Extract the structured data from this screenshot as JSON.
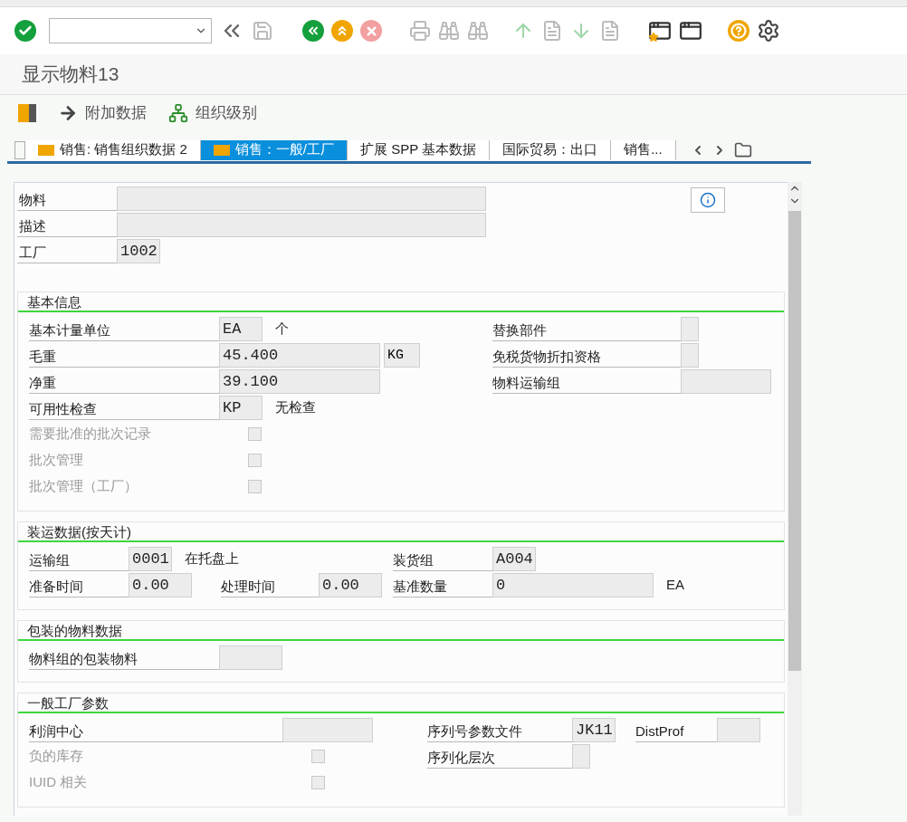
{
  "title": "显示物料13",
  "actions": [
    {
      "label": "附加数据"
    },
    {
      "label": "组织级别"
    }
  ],
  "tabs": [
    {
      "label": "销售: 销售组织数据 2",
      "selected": false
    },
    {
      "label": "销售：一般/工厂",
      "selected": true
    },
    {
      "label": "扩展 SPP 基本数据",
      "selected": false
    },
    {
      "label": "国际贸易：出口",
      "selected": false
    },
    {
      "label": "销售...",
      "selected": false
    }
  ],
  "header_fields": [
    {
      "label": "物料",
      "kind": "long"
    },
    {
      "label": "描述",
      "kind": "long"
    },
    {
      "label": "工厂",
      "kind": "code",
      "value": "1002"
    }
  ],
  "sections": [
    {
      "title": "基本信息",
      "kind": "basic",
      "rows": [
        [
          {
            "kind": "code",
            "label": "基本计量单位",
            "value": "EA",
            "suffix": "个"
          },
          {
            "kind": "flag",
            "label": "替换部件"
          }
        ],
        [
          {
            "kind": "quantity",
            "label": "毛重",
            "value": "45.400",
            "unit": "KG"
          },
          {
            "kind": "flag",
            "label": "免税货物折扣资格"
          }
        ],
        [
          {
            "kind": "quantity",
            "label": "净重",
            "value": "39.100"
          },
          {
            "kind": "wide",
            "label": "物料运输组"
          }
        ],
        [
          {
            "kind": "code",
            "label": "可用性检查",
            "value": "KP",
            "suffix": "无检查"
          }
        ],
        [
          {
            "kind": "checkbox",
            "label": "需要批准的批次记录",
            "checked": false,
            "disabled": true
          }
        ],
        [
          {
            "kind": "checkbox",
            "label": "批次管理",
            "checked": false,
            "disabled": true
          }
        ],
        [
          {
            "kind": "checkbox",
            "label": "批次管理（工厂）",
            "checked": false,
            "disabled": true
          }
        ]
      ]
    },
    {
      "title": "装运数据(按天计)",
      "kind": "shipping",
      "rows": [
        [
          {
            "kind": "code",
            "label": "运输组",
            "value": "0001",
            "suffix": "在托盘上"
          },
          {
            "kind": "blank"
          },
          {
            "kind": "code",
            "label": "装货组",
            "value": "A004"
          }
        ],
        [
          {
            "kind": "time",
            "label": "准备时间",
            "value": "0.00"
          },
          {
            "kind": "time",
            "label": "处理时间",
            "value": "0.00"
          },
          {
            "kind": "quantity",
            "label": "基准数量",
            "value": "0",
            "suffix": "EA"
          }
        ]
      ]
    },
    {
      "title": "包装的物料数据",
      "kind": "packaging",
      "rows": [
        [
          {
            "kind": "time",
            "label": "物料组的包装物料"
          }
        ]
      ]
    },
    {
      "title": "一般工厂参数",
      "kind": "plant",
      "rows": [
        [
          {
            "kind": "wide",
            "label": "利润中心"
          },
          {
            "kind": "code",
            "label": "序列号参数文件",
            "value": "JK11"
          },
          {
            "kind": "code",
            "label": "DistProf"
          }
        ],
        [
          {
            "kind": "checkbox",
            "label": "负的库存",
            "checked": false,
            "disabled": true
          },
          {
            "kind": "flag",
            "label": "序列化层次"
          }
        ],
        [
          {
            "kind": "checkbox",
            "label": "IUID 相关",
            "checked": false,
            "disabled": true
          }
        ]
      ]
    }
  ]
}
